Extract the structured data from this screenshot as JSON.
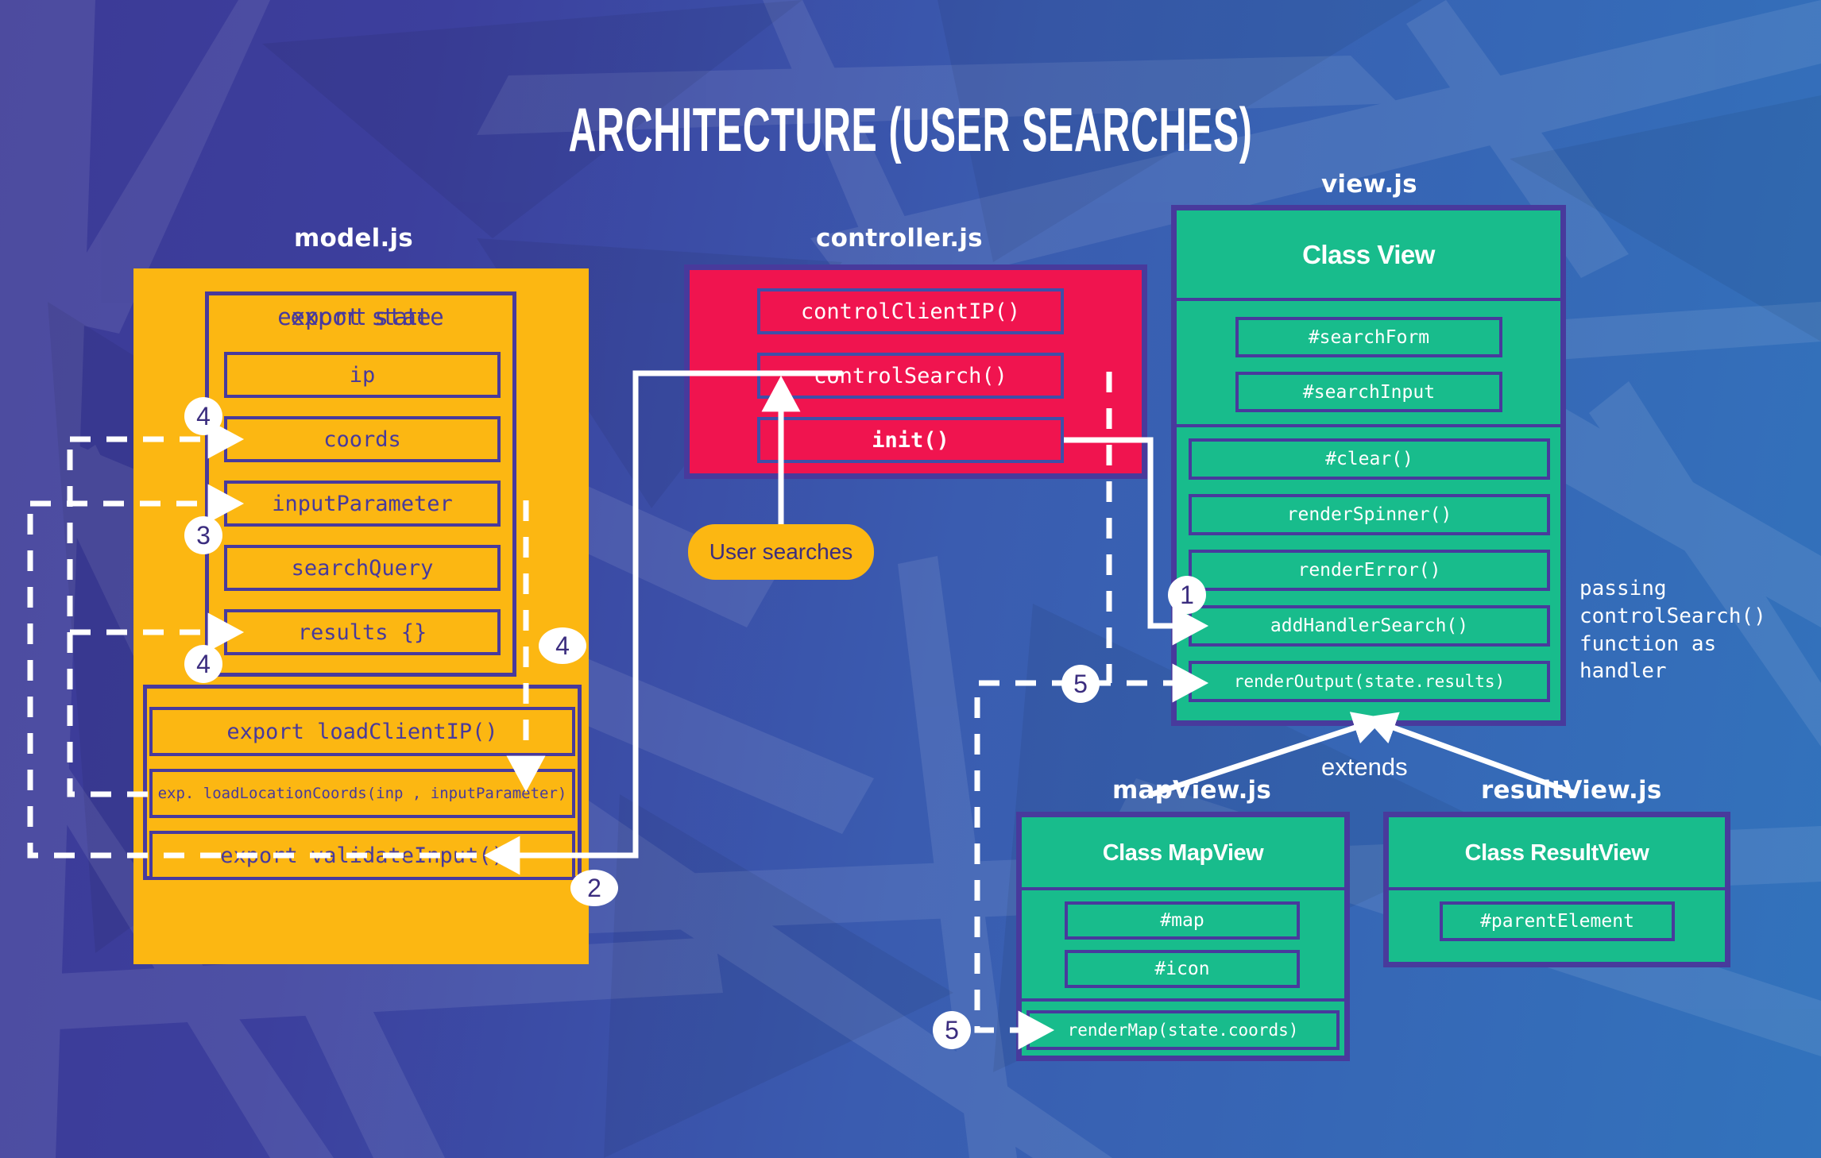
{
  "title": "ARCHITECTURE (USER SEARCHES)",
  "palette": {
    "model": "#fcb712",
    "controller": "#f0144f",
    "view": "#18bc8c",
    "stroke": "#483a9c",
    "bg_left": "#3c3a96",
    "bg_right": "#3273bc",
    "arrow": "#ffffff"
  },
  "model": {
    "label": "model.js",
    "state_group_title": "export state",
    "state_fields": [
      "ip",
      "coords",
      "inputParameter",
      "searchQuery",
      "results {}"
    ],
    "functions": [
      "export loadClientIP()",
      "exp. loadLocationCoords(inp , inputParameter)",
      "export validateInput()"
    ]
  },
  "controller": {
    "label": "controller.js",
    "functions": [
      "controlClientIP()",
      "controlSearch()",
      "init()"
    ]
  },
  "view": {
    "label": "view.js",
    "class_name": "Class View",
    "fields": [
      "#searchForm",
      "#searchInput"
    ],
    "methods": [
      "#clear()",
      "renderSpinner()",
      "renderError()",
      "addHandlerSearch()",
      "renderOutput(state.results)"
    ]
  },
  "map_view": {
    "label": "mapView.js",
    "class_name": "Class MapView",
    "fields": [
      "#map",
      "#icon"
    ],
    "methods": [
      "renderMap(state.coords)"
    ]
  },
  "result_view": {
    "label": "resultView.js",
    "class_name": "Class ResultView",
    "fields": [
      "#parentElement"
    ]
  },
  "trigger": {
    "label": "User searches"
  },
  "notes": {
    "handler": "passing\ncontrolSearch()\nfunction as\nhandler",
    "extends": "extends"
  },
  "steps": {
    "one": "1",
    "two": "2",
    "three": "3",
    "four_a": "4",
    "four_b": "4",
    "four_c": "4",
    "five_a": "5",
    "five_b": "5"
  }
}
